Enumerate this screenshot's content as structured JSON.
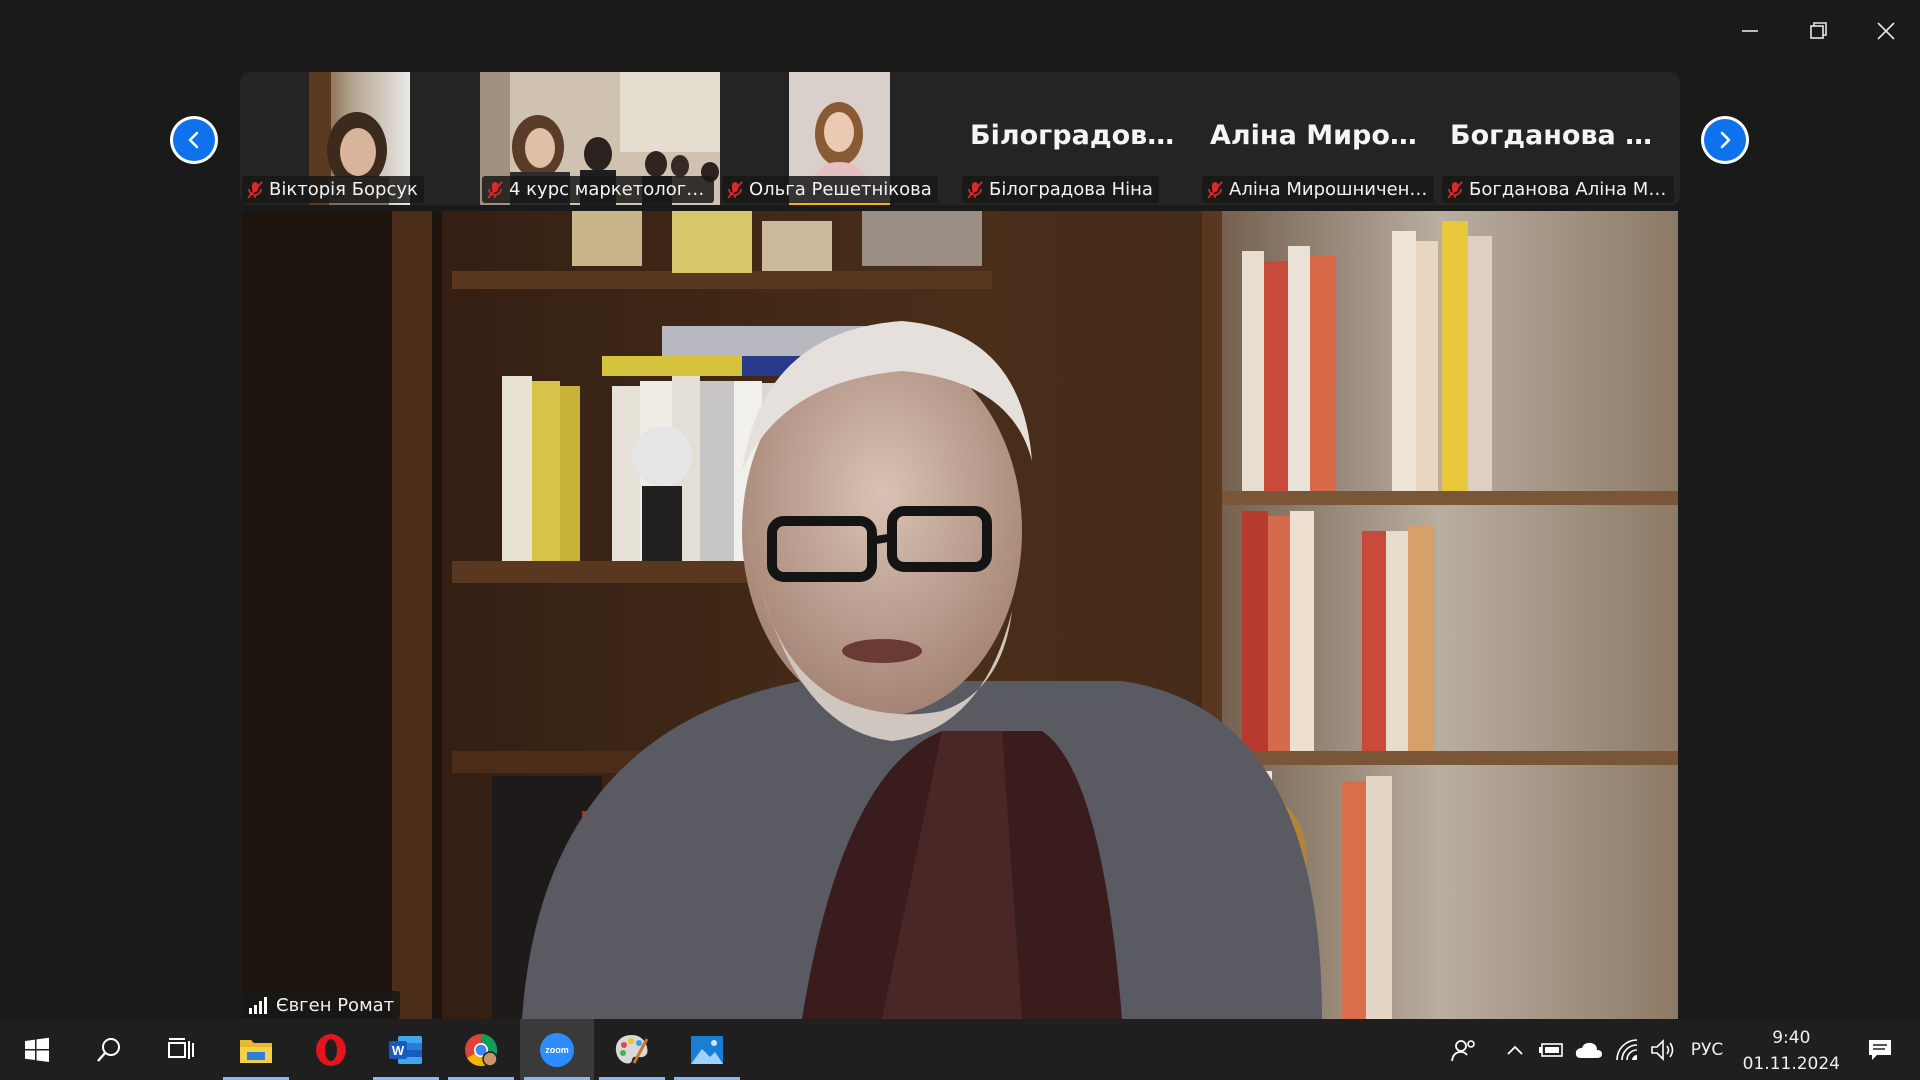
{
  "window": {
    "minimize_icon": "minimize-icon",
    "restore_icon": "restore-icon",
    "close_icon": "close-icon"
  },
  "gallery": {
    "participants": [
      {
        "name": "Вікторія Борсук",
        "has_video": true,
        "muted": true
      },
      {
        "name": "4 курс маркетологів ...",
        "has_video": true,
        "muted": true
      },
      {
        "name": "Ольга Решетнікова",
        "has_video": true,
        "muted": true,
        "speaking": true
      },
      {
        "name": "Білоградова Ніна",
        "display": "Білоградова  Ні...",
        "has_video": false,
        "muted": true
      },
      {
        "name": "Аліна Мирошниченко",
        "display": "Аліна  Мирошн...",
        "has_video": false,
        "muted": true
      },
      {
        "name": "Богданова Аліна МР-...",
        "display": "Богданова  Алі...",
        "has_video": false,
        "muted": true
      }
    ]
  },
  "active_speaker": {
    "name": "Євген Ромат"
  },
  "taskbar": {
    "apps": [
      "windows-start",
      "search",
      "task-view",
      "file-explorer",
      "opera",
      "word",
      "chrome",
      "zoom",
      "paint",
      "photos"
    ],
    "zoom_label": "zoom",
    "word_label": "W",
    "language": "РУС",
    "time": "9:40",
    "date": "01.11.2024"
  },
  "colors": {
    "accent_blue": "#0e72ed",
    "speaking_yellow": "#f2b21b",
    "muted_red": "#e02828"
  }
}
